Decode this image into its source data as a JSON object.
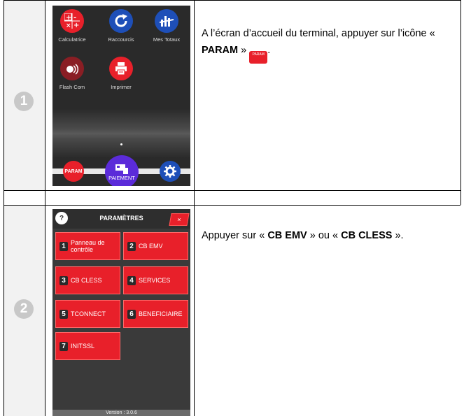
{
  "step1": {
    "number": "1",
    "instruction_before": "A l’écran d’accueil du terminal, appuyer sur l’icône « ",
    "instruction_bold": "PARAM",
    "instruction_after": " »",
    "inline_icon_label": "PARAM",
    "apps": [
      {
        "label": "Calculatrice",
        "icon": "calculator-icon"
      },
      {
        "label": "Raccourcis",
        "icon": "refresh-icon"
      },
      {
        "label": "Mes Totaux",
        "icon": "bar-chart-icon"
      },
      {
        "label": "Flash Com",
        "icon": "megaphone-icon"
      },
      {
        "label": "Imprimer",
        "icon": "printer-icon"
      }
    ],
    "dock": {
      "param_label": "PARAM",
      "paiement_label": "PAIEMENT",
      "settings_icon": "gear-icon"
    }
  },
  "step2": {
    "number": "2",
    "instruction_before": "Appuyer sur « ",
    "bold1": "CB EMV",
    "instruction_mid": " » ou « ",
    "bold2": "CB CLESS",
    "instruction_after": " ».",
    "screen_title": "PARAMÈTRES",
    "help_label": "?",
    "close_label": "×",
    "buttons": [
      {
        "key": "1",
        "label": "Panneau de contrôle"
      },
      {
        "key": "2",
        "label": "CB EMV"
      },
      {
        "key": "3",
        "label": "CB CLESS"
      },
      {
        "key": "4",
        "label": "SERVICES"
      },
      {
        "key": "5",
        "label": "TCONNECT"
      },
      {
        "key": "6",
        "label": "BENEFICIAIRE"
      },
      {
        "key": "7",
        "label": "INITSSL"
      }
    ],
    "version": "Version : 3.0.6"
  },
  "colors": {
    "red": "#e8202a",
    "blue": "#1e4fb8",
    "purple": "#5b2bd9",
    "circle": "#c8c8c8"
  }
}
